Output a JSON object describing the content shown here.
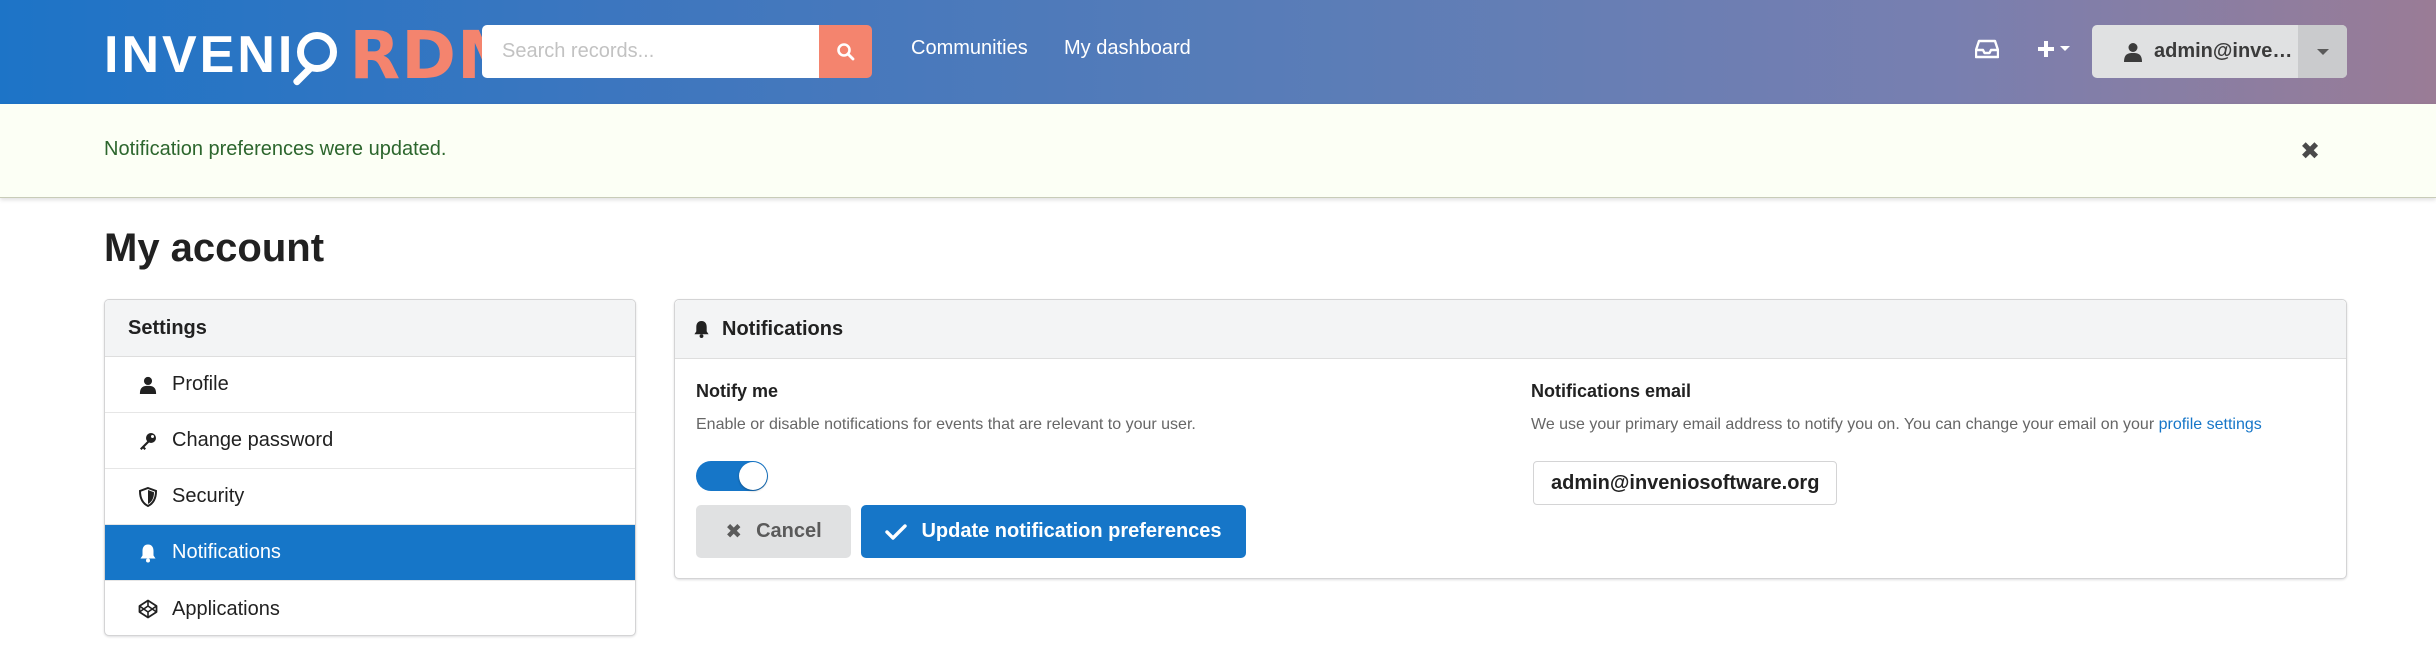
{
  "header": {
    "logo_main": "INVENI",
    "logo_accent": "RDM",
    "search_placeholder": "Search records...",
    "nav": {
      "communities": "Communities",
      "dashboard": "My dashboard"
    },
    "user_label": "admin@inveniosoftware.org",
    "icons": [
      "inbox-icon",
      "plus-icon",
      "chevron-down-icon",
      "user-icon",
      "search-icon"
    ]
  },
  "flash": {
    "message": "Notification preferences were updated."
  },
  "page": {
    "title": "My account"
  },
  "sidebar": {
    "header": "Settings",
    "items": [
      {
        "label": "Profile",
        "icon": "user-icon",
        "active": false
      },
      {
        "label": "Change password",
        "icon": "key-icon",
        "active": false
      },
      {
        "label": "Security",
        "icon": "shield-icon",
        "active": false
      },
      {
        "label": "Notifications",
        "icon": "bell-icon",
        "active": true
      },
      {
        "label": "Applications",
        "icon": "codepen-icon",
        "active": false
      }
    ]
  },
  "notifications": {
    "title": "Notifications",
    "notify_me": {
      "label": "Notify me",
      "description": "Enable or disable notifications for events that are relevant to your user.",
      "enabled": true
    },
    "email": {
      "label": "Notifications email",
      "description": "We use your primary email address to notify you on. You can change your email on your",
      "link_text": "profile settings",
      "address": "admin@inveniosoftware.org"
    },
    "buttons": {
      "cancel": "Cancel",
      "update": "Update notification preferences"
    }
  },
  "colors": {
    "primary": "#1676c8",
    "accent": "#f4846e",
    "success_text": "#2c662d"
  }
}
